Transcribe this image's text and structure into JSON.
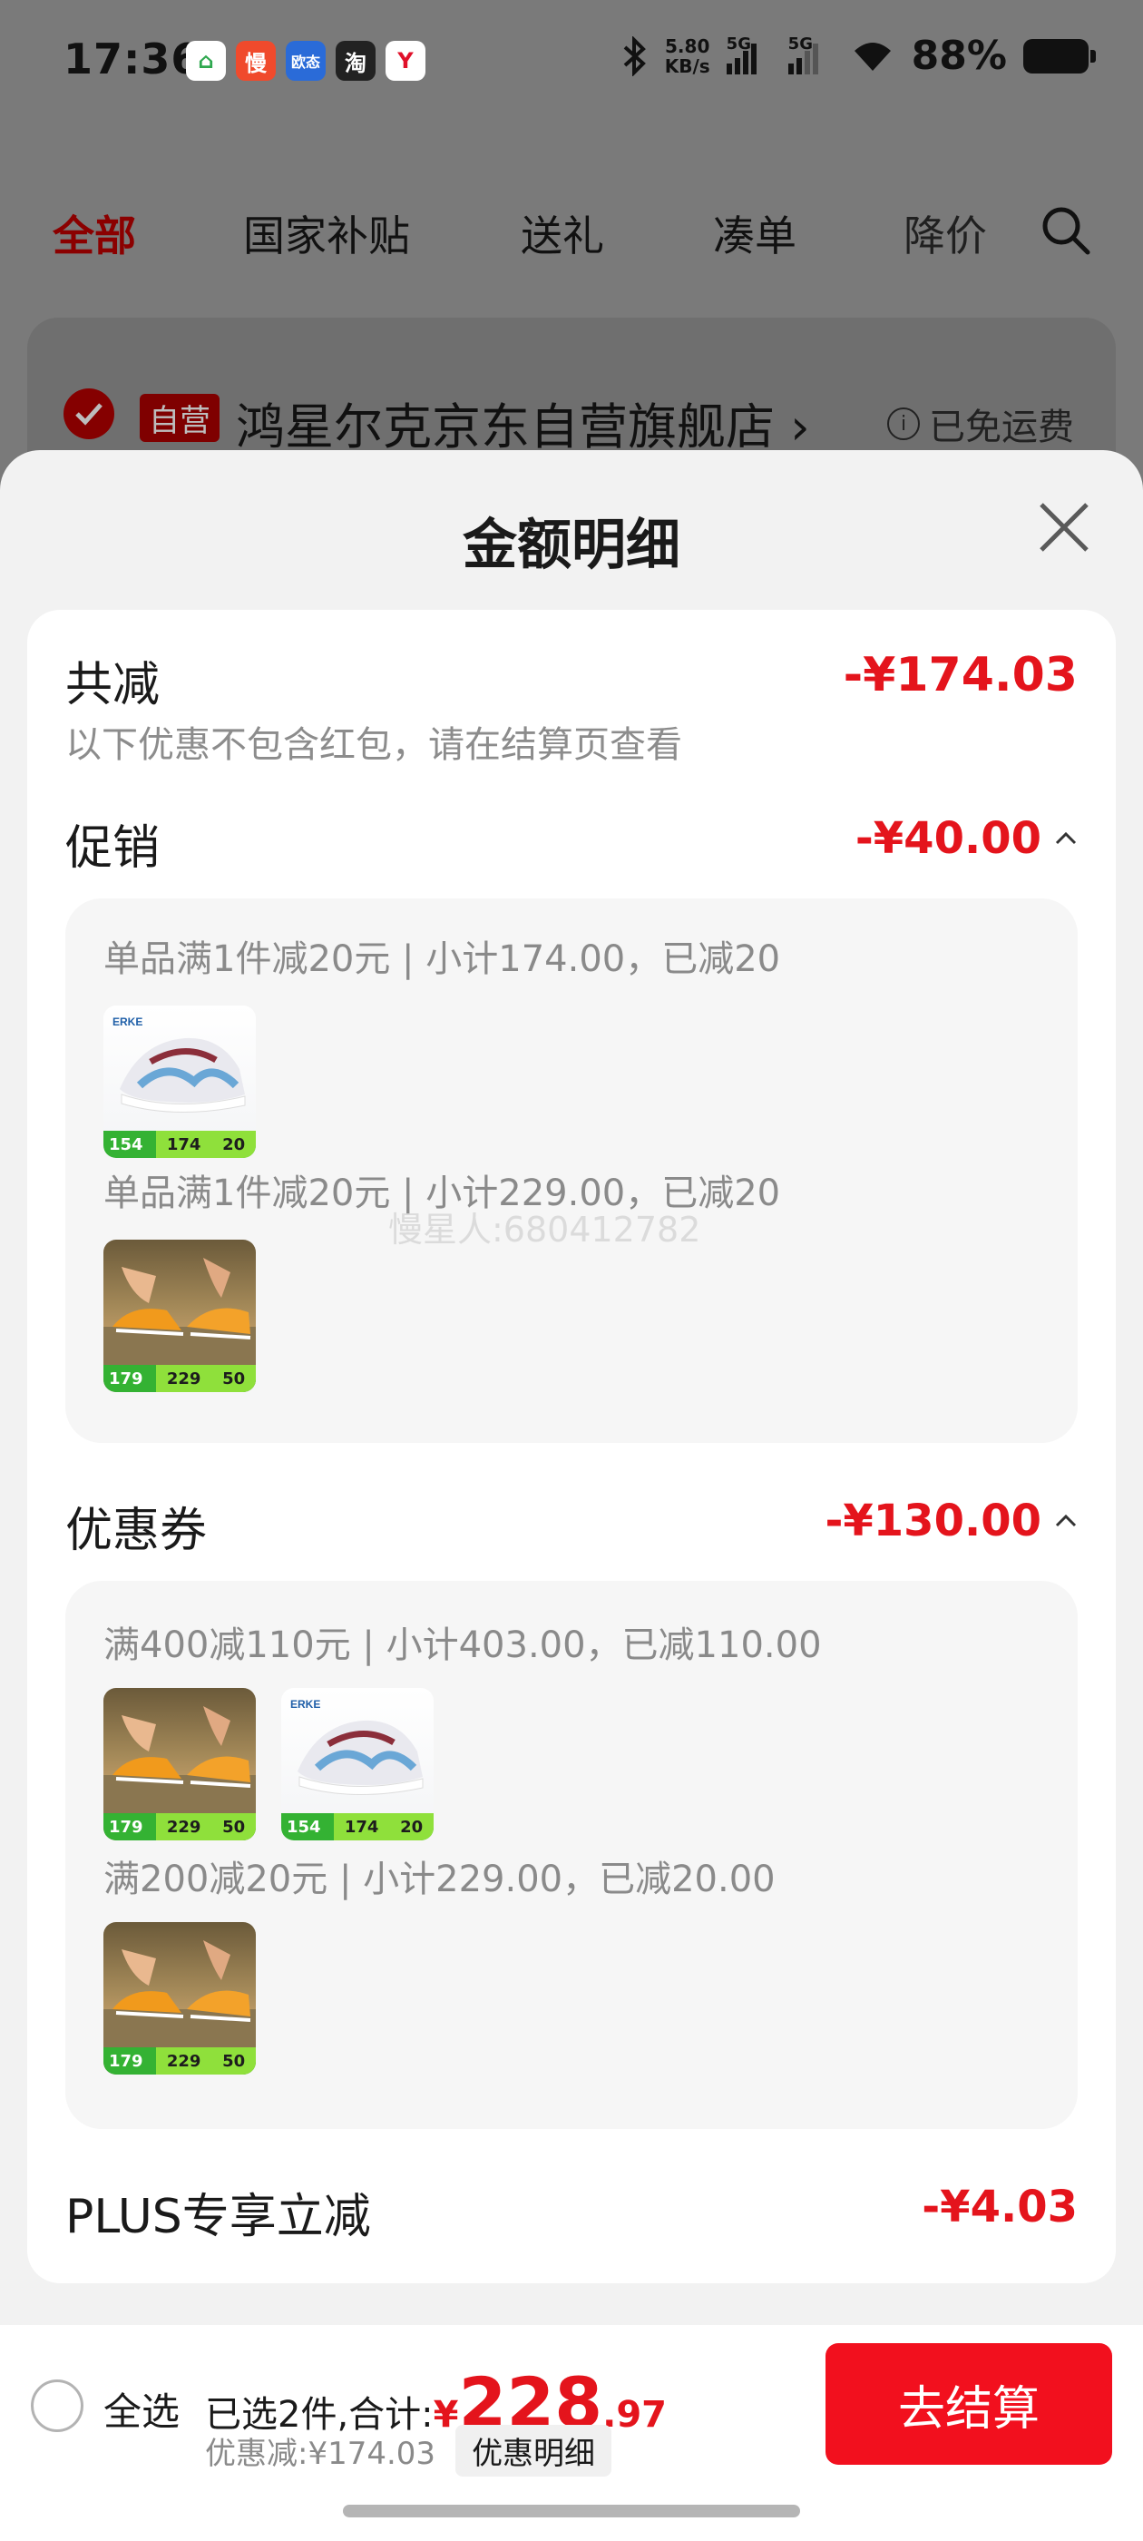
{
  "status_bar": {
    "time": "17:36",
    "apps": [
      {
        "icon": "home-app-icon",
        "glyph": "⌂",
        "color": "#ffffff",
        "fg": "#2fa84f"
      },
      {
        "icon": "man-app-icon",
        "glyph": "慢",
        "color": "#f04a2c",
        "fg": "#ffffff"
      },
      {
        "icon": "oumai-app-icon",
        "glyph": "欧态",
        "color": "#2a6bd8",
        "fg": "#ffffff"
      },
      {
        "icon": "taobao-app-icon",
        "glyph": "淘",
        "color": "#222222",
        "fg": "#ffffff"
      },
      {
        "icon": "red-y-app-icon",
        "glyph": "Y",
        "color": "#ffffff",
        "fg": "#e0102a"
      }
    ],
    "net_speed_top": "5.80",
    "net_speed_bottom": "KB/s",
    "signal1": "5G",
    "signal2": "5G",
    "battery": "88%"
  },
  "category_tabs": [
    {
      "label": "全部",
      "active": true
    },
    {
      "label": "国家补贴",
      "active": false
    },
    {
      "label": "送礼",
      "active": false
    },
    {
      "label": "凑单",
      "active": false
    },
    {
      "label": "降价",
      "active": false
    }
  ],
  "shop": {
    "badge": "自营",
    "name": "鸿星尔克京东自营旗舰店 ›",
    "shipping": "已免运费"
  },
  "sheet": {
    "title": "金额明细",
    "total_reduce": {
      "label": "共减",
      "amount": "-¥174.03",
      "note": "以下优惠不包含红包，请在结算页查看"
    },
    "promotion": {
      "label": "促销",
      "amount": "-¥40.00",
      "rules": [
        {
          "text": "单品满1件减20元 | 小计174.00，已减20",
          "thumbs": [
            {
              "style": "white",
              "tag_price": "154",
              "tag_a": "174",
              "tag_b": "20"
            }
          ]
        },
        {
          "text": "单品满1件减20元 | 小计229.00，已减20",
          "thumbs": [
            {
              "style": "run",
              "tag_price": "179",
              "tag_a": "229",
              "tag_b": "50"
            }
          ]
        }
      ]
    },
    "coupon": {
      "label": "优惠券",
      "amount": "-¥130.00",
      "rules": [
        {
          "text": "满400减110元 | 小计403.00，已减110.00",
          "thumbs": [
            {
              "style": "run",
              "tag_price": "179",
              "tag_a": "229",
              "tag_b": "50"
            },
            {
              "style": "white",
              "tag_price": "154",
              "tag_a": "174",
              "tag_b": "20"
            }
          ]
        },
        {
          "text": "满200减20元 | 小计229.00，已减20.00",
          "thumbs": [
            {
              "style": "run",
              "tag_price": "179",
              "tag_a": "229",
              "tag_b": "50"
            }
          ]
        }
      ]
    },
    "plus": {
      "label": "PLUS专享立减",
      "amount": "-¥4.03"
    },
    "watermark": "慢星人:680412782"
  },
  "bottom_bar": {
    "select_all": "全选",
    "total_prefix": "已选2件,合计:",
    "currency": "¥",
    "total_int": "228",
    "total_dec": ".97",
    "discount_text": "优惠减:¥174.03",
    "discount_btn": "优惠明细",
    "checkout": "去结算"
  },
  "colors": {
    "accent_red": "#e4141c",
    "checkout_red": "#f2101e"
  }
}
